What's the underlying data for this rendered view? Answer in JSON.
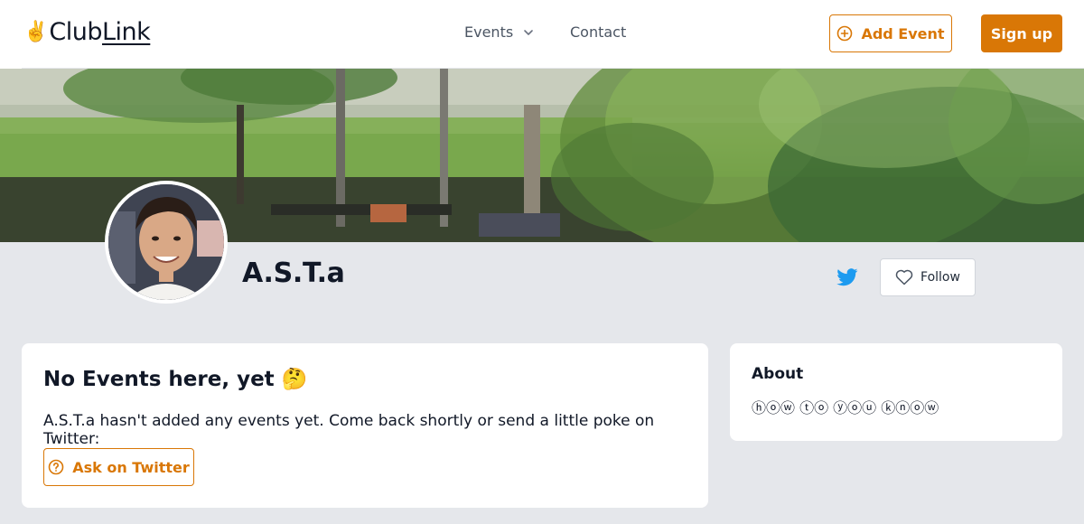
{
  "header": {
    "logo": {
      "emoji": "✌️",
      "part1": "Club",
      "part2": "Link"
    },
    "nav": [
      {
        "label": "Events"
      },
      {
        "label": "Contact"
      }
    ],
    "add_event_label": "Add Event",
    "sign_up_label": "Sign up"
  },
  "profile": {
    "name": "A.S.T.a",
    "follow_label": "Follow"
  },
  "events_card": {
    "title": "No Events here, yet 🤔",
    "description": "A.S.T.a hasn't added any events yet. Come back shortly or send a little poke on Twitter:",
    "ask_label": "Ask on Twitter"
  },
  "about_card": {
    "title": "About",
    "text": "ⓗⓞⓦ ⓣⓞ ⓨⓞⓤ ⓚⓝⓞⓦ"
  },
  "colors": {
    "accent": "#d97706",
    "twitter": "#1d9bf0",
    "background": "#e5e7eb"
  },
  "icons": {
    "nav_chevron": "chevron-down-icon",
    "add_event": "plus-circle-icon",
    "twitter": "twitter-icon",
    "follow": "heart-icon",
    "ask": "question-circle-icon"
  }
}
